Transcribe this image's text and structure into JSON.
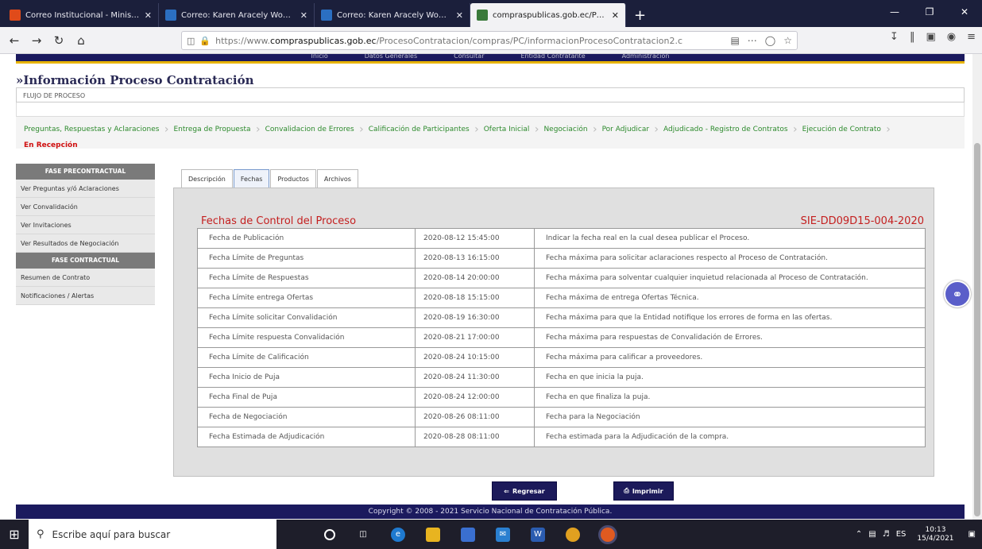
{
  "browser": {
    "tabs": [
      {
        "title": "Correo Institucional - Minister",
        "color": "#e04b1a"
      },
      {
        "title": "Correo: Karen Aracely Wonsan",
        "color": "#2b6fc2"
      },
      {
        "title": "Correo: Karen Aracely Wonsan",
        "color": "#2b6fc2"
      },
      {
        "title": "compraspublicas.gob.ec/Proce",
        "color": "#3a7a3a"
      }
    ],
    "url_prefix": "https://www.",
    "url_domain": "compraspublicas.gob.ec",
    "url_path": "/ProcesoContratacion/compras/PC/informacionProcesoContratacion2.c"
  },
  "topnav": [
    "Inicio",
    "Datos Generales",
    "Consultar",
    "Entidad Contratante",
    "Administración"
  ],
  "page": {
    "title": "»Información Proceso Contratación",
    "flow_label": "FLUJO DE PROCESO"
  },
  "steps": [
    "Preguntas, Respuestas y Aclaraciones",
    "Entrega de Propuesta",
    "Convalidacion de Errores",
    "Calificación de Participantes",
    "Oferta Inicial",
    "Negociación",
    "Por Adjudicar",
    "Adjudicado - Registro de Contratos",
    "Ejecución de Contrato",
    "En Recepción"
  ],
  "menu": {
    "pre_head": "FASE PRECONTRACTUAL",
    "pre_items": [
      "Ver Preguntas y/ó Aclaraciones",
      "Ver Convalidación",
      "Ver Invitaciones",
      "Ver Resultados de Negociación"
    ],
    "con_head": "FASE CONTRACTUAL",
    "con_items": [
      "Resumen de Contrato",
      "Notificaciones / Alertas"
    ]
  },
  "tabs": [
    "Descripción",
    "Fechas",
    "Productos",
    "Archivos"
  ],
  "content": {
    "title": "Fechas de Control del Proceso",
    "process_code": "SIE-DD09D15-004-2020",
    "rows": [
      {
        "label": "Fecha de Publicación",
        "date": "2020-08-12 15:45:00",
        "desc": "Indicar la fecha real en la cual desea publicar el Proceso."
      },
      {
        "label": "Fecha Límite de Preguntas",
        "date": "2020-08-13 16:15:00",
        "desc": "Fecha máxima para solicitar aclaraciones respecto al Proceso de Contratación."
      },
      {
        "label": "Fecha Límite de Respuestas",
        "date": "2020-08-14 20:00:00",
        "desc": "Fecha máxima para solventar cualquier inquietud relacionada al Proceso de Contratación."
      },
      {
        "label": "Fecha Límite entrega Ofertas",
        "date": "2020-08-18 15:15:00",
        "desc": "Fecha máxima de entrega Ofertas Técnica."
      },
      {
        "label": "Fecha Límite solicitar Convalidación",
        "date": "2020-08-19 16:30:00",
        "desc": "Fecha máxima para que la Entidad notifique los errores de forma en las ofertas."
      },
      {
        "label": "Fecha Límite respuesta Convalidación",
        "date": "2020-08-21 17:00:00",
        "desc": "Fecha máxima para respuestas de Convalidación de Errores."
      },
      {
        "label": "Fecha Límite de Calificación",
        "date": "2020-08-24 10:15:00",
        "desc": "Fecha máxima para calificar a proveedores."
      },
      {
        "label": "Fecha Inicio de Puja",
        "date": "2020-08-24 11:30:00",
        "desc": "Fecha en que inicia la puja."
      },
      {
        "label": "Fecha Final de Puja",
        "date": "2020-08-24 12:00:00",
        "desc": "Fecha en que finaliza la puja."
      },
      {
        "label": "Fecha de Negociación",
        "date": "2020-08-26 08:11:00",
        "desc": "Fecha para la Negociación"
      },
      {
        "label": "Fecha Estimada de Adjudicación",
        "date": "2020-08-28 08:11:00",
        "desc": "Fecha estimada para la Adjudicación de la compra."
      }
    ]
  },
  "buttons": {
    "back": "Regresar",
    "print": "Imprimir"
  },
  "footer": "Copyright © 2008 - 2021 Servicio Nacional de Contratación Pública.",
  "taskbar": {
    "search_placeholder": "Escribe aquí para buscar",
    "time": "10:13",
    "date": "15/4/2021"
  }
}
